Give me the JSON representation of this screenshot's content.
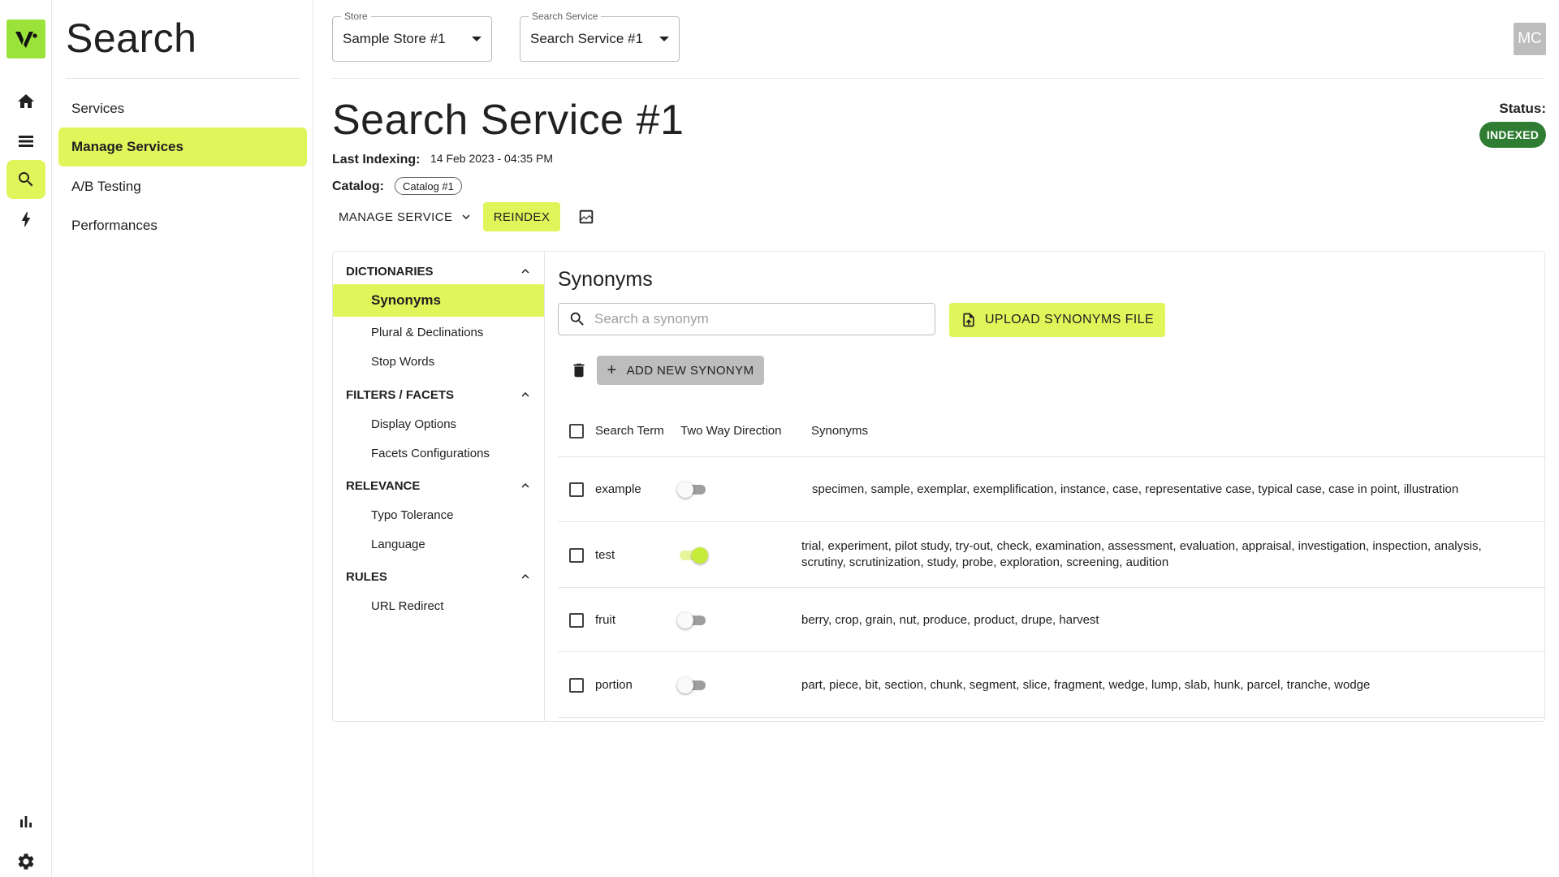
{
  "rail": {
    "items": [
      "home-icon",
      "list-icon",
      "search-icon",
      "bolt-icon"
    ],
    "bottom": [
      "bar-chart-icon",
      "gear-icon"
    ]
  },
  "sidenav": {
    "title": "Search",
    "items": [
      {
        "label": "Services",
        "active": false
      },
      {
        "label": "Manage Services",
        "active": true
      },
      {
        "label": "A/B Testing",
        "active": false
      },
      {
        "label": "Performances",
        "active": false
      }
    ]
  },
  "topbar": {
    "store": {
      "legend": "Store",
      "value": "Sample Store #1"
    },
    "service": {
      "legend": "Search Service",
      "value": "Search Service #1"
    },
    "avatar": "MC"
  },
  "service": {
    "title": "Search Service #1",
    "last_indexing_label": "Last Indexing:",
    "last_indexing_value": "14 Feb 2023 - 04:35 PM",
    "catalog_label": "Catalog:",
    "catalog_value": "Catalog #1",
    "status_label": "Status:",
    "status_value": "INDEXED",
    "status_color": "#2e7d32",
    "manage_label": "MANAGE SERVICE",
    "reindex_label": "REINDEX"
  },
  "settings_nav": {
    "sections": [
      {
        "label": "DICTIONARIES",
        "items": [
          "Synonyms",
          "Plural & Declinations",
          "Stop Words"
        ]
      },
      {
        "label": "FILTERS / FACETS",
        "items": [
          "Display Options",
          "Facets Configurations"
        ]
      },
      {
        "label": "RELEVANCE",
        "items": [
          "Typo Tolerance",
          "Language"
        ]
      },
      {
        "label": "RULES",
        "items": [
          "URL Redirect"
        ]
      }
    ],
    "active": "Synonyms"
  },
  "synonyms": {
    "title": "Synonyms",
    "search_placeholder": "Search a synonym",
    "upload_label": "UPLOAD SYNONYMS FILE",
    "add_label": "ADD NEW SYNONYM",
    "columns": [
      "Search Term",
      "Two Way Direction",
      "Synonyms"
    ],
    "rows": [
      {
        "term": "example",
        "two_way": false,
        "synonyms": "specimen, sample, exemplar, exemplification, instance, case, representative case, typical case, case in point, illustration"
      },
      {
        "term": "test",
        "two_way": true,
        "synonyms": "trial, experiment, pilot study, try-out, check, examination, assessment, evaluation, appraisal, investigation, inspection, analysis, scrutiny, scrutinization, study, probe, exploration, screening, audition"
      },
      {
        "term": "fruit",
        "two_way": false,
        "synonyms": "berry, crop, grain, nut, produce, product, drupe, harvest"
      },
      {
        "term": "portion",
        "two_way": false,
        "synonyms": "part, piece, bit, section, chunk, segment, slice, fragment, wedge, lump, slab, hunk, parcel, tranche, wodge"
      }
    ]
  },
  "colors": {
    "accent": "#dff55a",
    "logo": "#9be23b",
    "status": "#2e7d32"
  }
}
